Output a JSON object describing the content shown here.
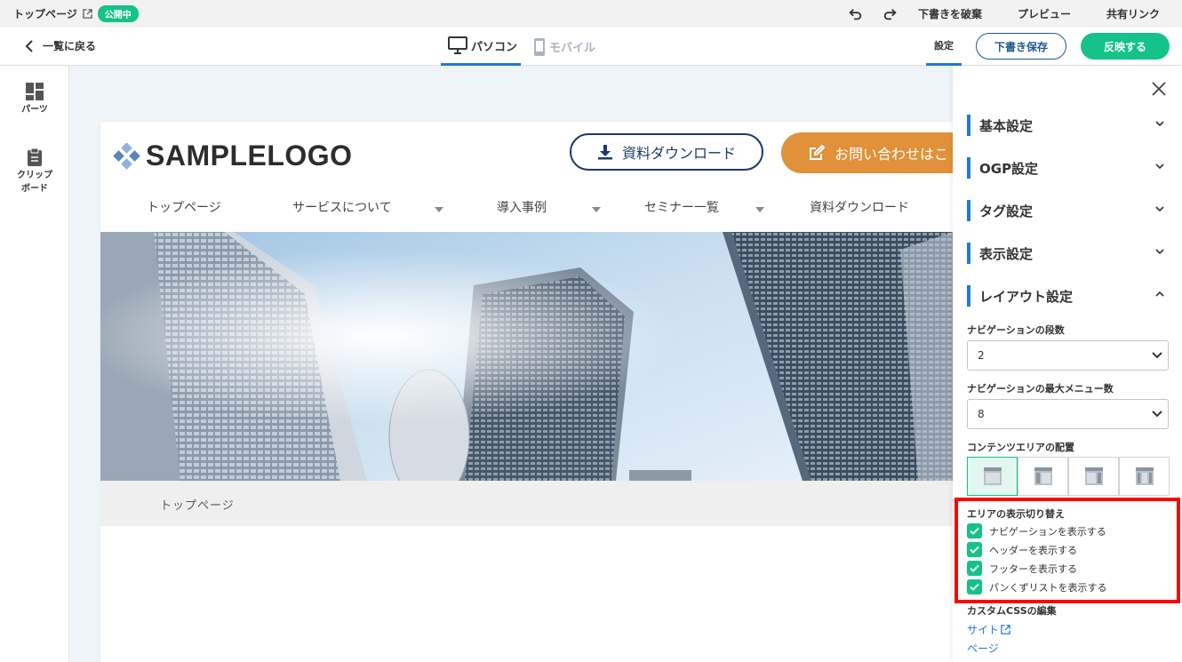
{
  "topbar": {
    "page_name": "トップページ",
    "status_badge": "公開中",
    "discard_draft": "下書きを破棄",
    "preview": "プレビュー",
    "share_link": "共有リンク"
  },
  "subheader": {
    "back": "一覧に戻る",
    "tab_pc": "パソコン",
    "tab_mobile": "モバイル",
    "settings": "設定",
    "save_draft": "下書き保存",
    "publish": "反映する"
  },
  "rail": {
    "parts": "パーツ",
    "clipboard_line1": "クリップ",
    "clipboard_line2": "ボード"
  },
  "site": {
    "logo": "SAMPLELOGO",
    "download_btn": "資料ダウンロード",
    "contact_btn": "お問い合わせはこ",
    "nav": [
      {
        "label": "トップページ",
        "has_caret": false
      },
      {
        "label": "サービスについて",
        "has_caret": true
      },
      {
        "label": "導入事例",
        "has_caret": true
      },
      {
        "label": "セミナー一覧",
        "has_caret": true
      },
      {
        "label": "資料ダウンロード",
        "has_caret": false
      }
    ],
    "breadcrumb": "トップページ"
  },
  "panel": {
    "sections": [
      "基本設定",
      "OGP設定",
      "タグ設定",
      "表示設定",
      "レイアウト設定"
    ],
    "nav_rows_label": "ナビゲーションの段数",
    "nav_rows_value": "2",
    "nav_max_label": "ナビゲーションの最大メニュー数",
    "nav_max_value": "8",
    "content_layout_label": "コンテンツエリアの配置",
    "area_toggle_label": "エリアの表示切り替え",
    "toggles": [
      {
        "label": "ナビゲーションを表示する",
        "checked": true
      },
      {
        "label": "ヘッダーを表示する",
        "checked": true
      },
      {
        "label": "フッターを表示する",
        "checked": true
      },
      {
        "label": "パンくずリストを表示する",
        "checked": true
      }
    ],
    "custom_css_label": "カスタムCSSの編集",
    "link_site": "サイト",
    "link_page": "ページ"
  },
  "colors": {
    "accent_green": "#14c28a",
    "accent_blue": "#1f7ad8",
    "contact_orange": "#e0913a",
    "highlight_red": "#ff0000"
  }
}
